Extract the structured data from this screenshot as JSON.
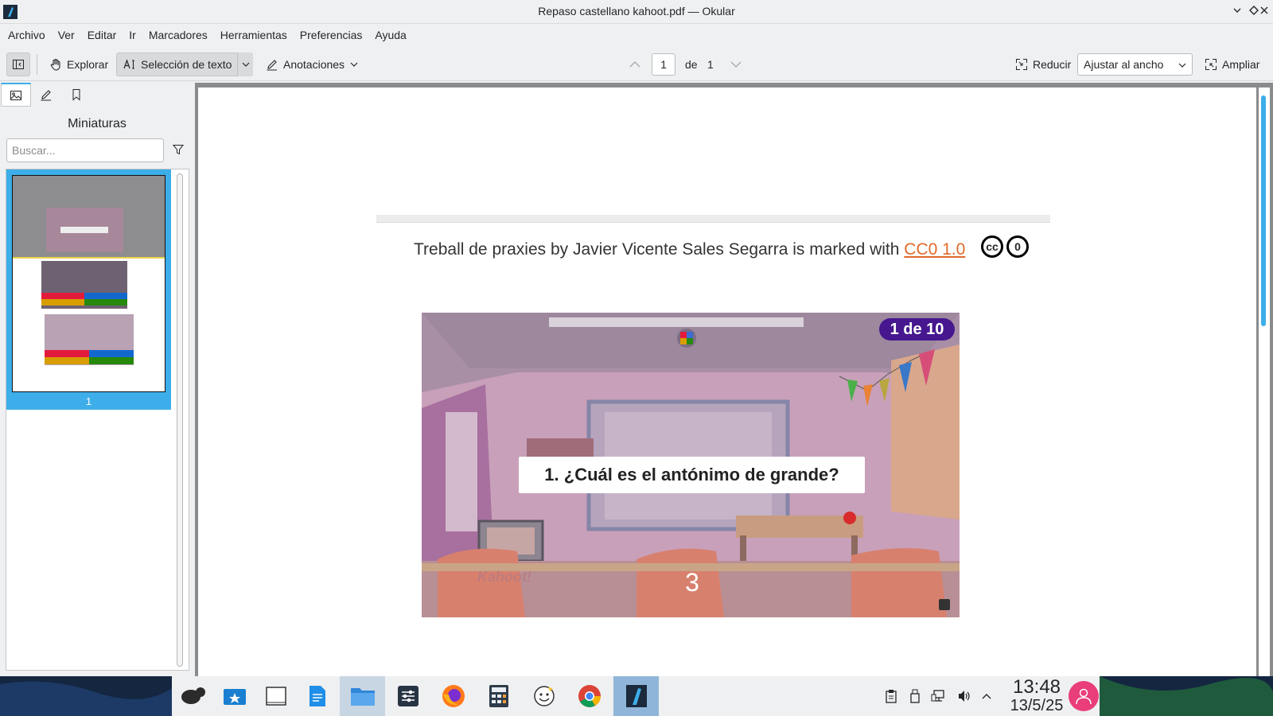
{
  "window": {
    "title": "Repaso castellano kahoot.pdf — Okular"
  },
  "menu": [
    "Archivo",
    "Ver",
    "Editar",
    "Ir",
    "Marcadores",
    "Herramientas",
    "Preferencias",
    "Ayuda"
  ],
  "toolbar": {
    "browse": "Explorar",
    "text_selection": "Selección de texto",
    "annotations": "Anotaciones",
    "page_current": "1",
    "page_of": "de",
    "page_total": "1",
    "zoom_out": "Reducir",
    "zoom_mode": "Ajustar al ancho",
    "zoom_in": "Ampliar"
  },
  "sidebar": {
    "title": "Miniaturas",
    "search_placeholder": "Buscar...",
    "thumbnail_page": "1"
  },
  "document": {
    "credit_prefix": "Treball de praxies by Javier Vicente Sales Segarra is marked with ",
    "license": "CC0 1.0",
    "cc_icon": "cc",
    "zero_icon": "0",
    "slide": {
      "counter": "1 de 10",
      "question": "1. ¿Cuál es el antónimo de grande?",
      "timer": "3",
      "watermark": "Kahoot!"
    }
  },
  "taskbar": {
    "time": "13:48",
    "date": "13/5/25"
  },
  "colors": {
    "accent": "#3daee9",
    "kahoot_purple": "#46178f",
    "link": "#e06a2b",
    "user_avatar": "#e93e7a"
  }
}
